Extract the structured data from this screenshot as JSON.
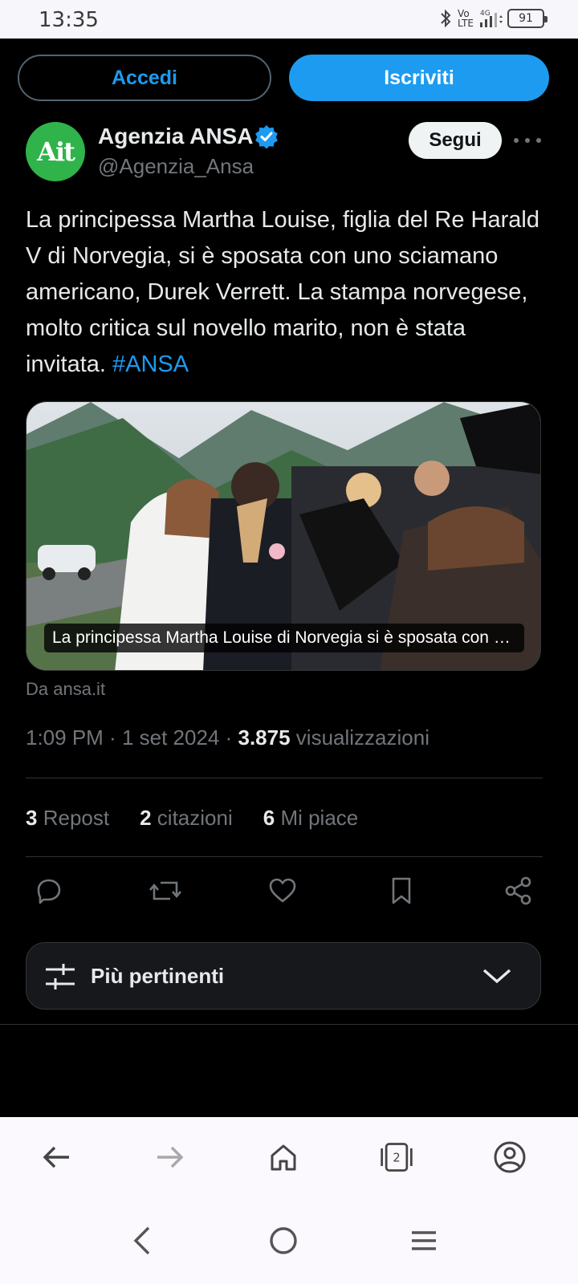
{
  "status_bar": {
    "time": "13:35",
    "network_top": "Vo",
    "network_bottom": "LTE",
    "network_gen": "4G",
    "battery": "91"
  },
  "header": {
    "login_label": "Accedi",
    "signup_label": "Iscriviti"
  },
  "author": {
    "avatar_text": "Ait",
    "name": "Agenzia ANSA",
    "handle": "@Agenzia_Ansa",
    "follow_label": "Segui"
  },
  "tweet": {
    "text": "La principessa Martha Louise, figlia del Re Harald V di Norvegia,  si è sposata con uno sciamano americano,  Durek Verrett. La stampa norvegese, molto critica sul novello marito, non è stata invitata. ",
    "hashtag": "#ANSA",
    "media_caption": "La principessa Martha Louise di Norvegia si è sposata con uno sciamano americano",
    "source": "Da ansa.it",
    "time": "1:09 PM",
    "date": "1 set 2024",
    "views_count": "3.875",
    "views_label": "visualizzazioni",
    "reposts_count": "3",
    "reposts_label": "Repost",
    "quotes_count": "2",
    "quotes_label": "citazioni",
    "likes_count": "6",
    "likes_label": "Mi piace"
  },
  "replies_sort": {
    "label": "Più pertinenti"
  },
  "browser": {
    "tabs_count": "2"
  },
  "colors": {
    "accent": "#1d9bf0",
    "background": "#000000",
    "secondary_text": "#71767b",
    "avatar_green": "#2fb34a"
  }
}
